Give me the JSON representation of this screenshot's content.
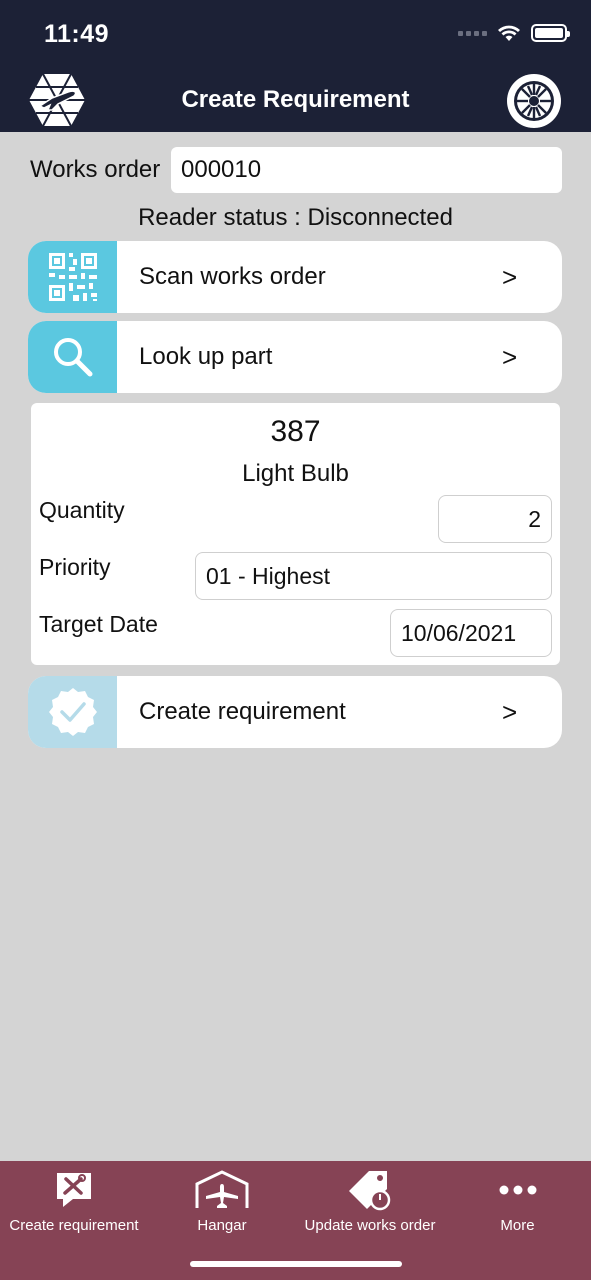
{
  "status_bar": {
    "time": "11:49"
  },
  "header": {
    "title": "Create Requirement"
  },
  "works_order": {
    "label": "Works order",
    "value": "000010"
  },
  "reader": {
    "label": "Reader status :",
    "value": "Disconnected"
  },
  "actions": {
    "scan": {
      "label": "Scan works order",
      "chevron": ">"
    },
    "lookup": {
      "label": "Look up part",
      "chevron": ">"
    },
    "create": {
      "label": "Create requirement",
      "chevron": ">"
    }
  },
  "part": {
    "number": "387",
    "name": "Light Bulb",
    "quantity_label": "Quantity",
    "quantity_value": "2",
    "priority_label": "Priority",
    "priority_value": "01 - Highest",
    "target_date_label": "Target Date",
    "target_date_value": "10/06/2021"
  },
  "tabs": [
    {
      "label": "Create requirement",
      "icon": "tools-icon"
    },
    {
      "label": "Hangar",
      "icon": "hangar-icon"
    },
    {
      "label": "Update works order",
      "icon": "tag-timer-icon"
    },
    {
      "label": "More",
      "icon": "more-icon"
    }
  ],
  "colors": {
    "header_bg": "#1c2136",
    "tabbar_bg": "#864355",
    "accent_cyan": "#5bc8e0",
    "accent_disabled": "#b5dbe9",
    "page_bg": "#d4d4d4"
  }
}
